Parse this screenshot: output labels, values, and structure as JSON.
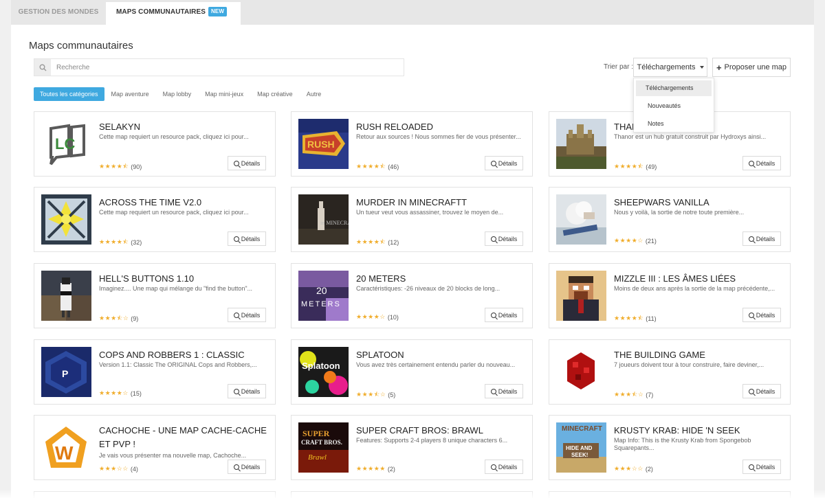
{
  "tabs": [
    {
      "label": "GESTION DES MONDES"
    },
    {
      "label": "MAPS COMMUNAUTAIRES",
      "badge": "NEW"
    }
  ],
  "page_title": "Maps communautaires",
  "search": {
    "placeholder": "Recherche",
    "value": ""
  },
  "sort": {
    "label": "Trier par :",
    "selected": "Téléchargements",
    "options": [
      "Téléchargements",
      "Nouveautés",
      "Notes"
    ]
  },
  "propose_label": "Proposer une map",
  "categories": [
    "Toutes les catégories",
    "Map aventure",
    "Map lobby",
    "Map mini-jeux",
    "Map créative",
    "Autre"
  ],
  "details_label": "Détails",
  "colors": {
    "accent": "#3fa9e0",
    "star": "#f0ad2c"
  },
  "maps": [
    {
      "title": "SELAKYN",
      "desc": "Cette map requiert un resource pack, cliquez ici pour...",
      "stars": "★★★★⯪",
      "reviews": "(90)"
    },
    {
      "title": "RUSH RELOADED",
      "desc": "Retour aux sources ! Nous sommes fier de vous présenter...",
      "stars": "★★★★⯪",
      "reviews": "(46)"
    },
    {
      "title": "THANOR",
      "desc": "Thanor est un hub gratuit construit par Hydroxys ainsi...",
      "stars": "★★★★⯪",
      "reviews": "(49)"
    },
    {
      "title": "ACROSS THE TIME V2.0",
      "desc": "Cette map requiert un resource pack, cliquez ici pour...",
      "stars": "★★★★⯪",
      "reviews": "(32)"
    },
    {
      "title": "MURDER IN MINECRAFTT",
      "desc": "Un tueur veut vous assassiner, trouvez le moyen de...",
      "stars": "★★★★⯪",
      "reviews": "(12)"
    },
    {
      "title": "SHEEPWARS VANILLA",
      "desc": "Nous y voilà, la sortie de notre toute première...",
      "stars": "★★★★☆",
      "reviews": "(21)"
    },
    {
      "title": "HELL'S BUTTONS 1.10",
      "desc": "Imaginez.... Une map qui mélange du \"find the button\"...",
      "stars": "★★★⯪☆",
      "reviews": "(9)"
    },
    {
      "title": "20 METERS",
      "desc": "Caractéristiques: -26 niveaux de 20 blocks de long...",
      "stars": "★★★★☆",
      "reviews": "(10)"
    },
    {
      "title": "MIZZLE III : LES ÂMES LIÉES",
      "desc": "Moins de deux ans après la sortie de la map précédente,...",
      "stars": "★★★★⯪",
      "reviews": "(11)"
    },
    {
      "title": "COPS AND ROBBERS 1 : CLASSIC",
      "desc": "Version 1.1: Classic  The ORIGINAL Cops and Robbers,...",
      "stars": "★★★★☆",
      "reviews": "(15)"
    },
    {
      "title": "SPLATOON",
      "desc": "Vous avez très certainement entendu parler du nouveau...",
      "stars": "★★★⯪☆",
      "reviews": "(5)"
    },
    {
      "title": "THE BUILDING GAME",
      "desc": "7 joueurs doivent tour à tour construire, faire deviner,...",
      "stars": "★★★⯪☆",
      "reviews": "(7)"
    },
    {
      "title": "CACHOCHE - UNE MAP CACHE-CACHE ET PVP !",
      "desc": "Je vais vous présenter ma nouvelle map, Cachoche...",
      "stars": "★★★☆☆",
      "reviews": "(4)"
    },
    {
      "title": "SUPER CRAFT BROS: BRAWL",
      "desc": "Features:  Supports 2-4 players  8 unique characters  6...",
      "stars": "★★★★★",
      "reviews": "(2)"
    },
    {
      "title": "KRUSTY KRAB: HIDE 'N SEEK",
      "desc": "Map Info: This is the Krusty Krab from Spongebob Squarepants...",
      "stars": "★★★☆☆",
      "reviews": "(2)"
    }
  ]
}
